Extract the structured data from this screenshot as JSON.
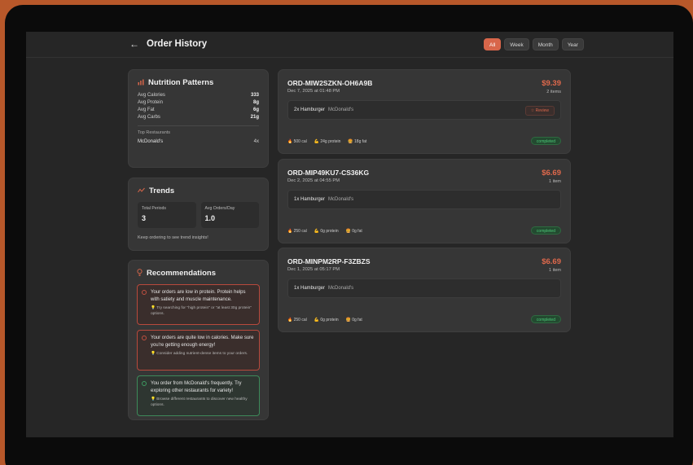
{
  "header": {
    "back_icon": "←",
    "title": "Order History",
    "filters": [
      {
        "label": "All",
        "active": true
      },
      {
        "label": "Week",
        "active": false
      },
      {
        "label": "Month",
        "active": false
      },
      {
        "label": "Year",
        "active": false
      }
    ]
  },
  "nutrition": {
    "title": "Nutrition Patterns",
    "stats": [
      {
        "label": "Avg Calories",
        "value": "333"
      },
      {
        "label": "Avg Protein",
        "value": "8g"
      },
      {
        "label": "Avg Fat",
        "value": "6g"
      },
      {
        "label": "Avg Carbs",
        "value": "21g"
      }
    ],
    "top_restaurants_label": "Top Restaurants",
    "restaurants": [
      {
        "name": "McDonald's",
        "count": "4x"
      }
    ]
  },
  "trends": {
    "title": "Trends",
    "total_periods_label": "Total Periods",
    "total_periods": "3",
    "avg_orders_label": "Avg Orders/Day",
    "avg_orders": "1.0",
    "hint": "Keep ordering to see trend insights!"
  },
  "recommendations": {
    "title": "Recommendations",
    "items": [
      {
        "text": "Your orders are low in protein. Protein helps with satiety and muscle maintenance.",
        "tip": "💡 Try searching for \"high protein\" or \"at least 30g protein\" options."
      },
      {
        "text": "Your orders are quite low in calories. Make sure you're getting enough energy!",
        "tip": "💡 Consider adding nutrient-dense items to your orders."
      },
      {
        "text": "You order from McDonald's frequently. Try exploring other restaurants for variety!",
        "tip": "💡 Browse different restaurants to discover new healthy options."
      }
    ]
  },
  "orders": [
    {
      "id": "ORD-MIW2SZKN-OH6A9B",
      "date": "Dec 7, 2025 at 01:48 PM",
      "price": "$9.39",
      "count": "2 items",
      "item": "2x Hamburger",
      "restaurant": "McDonald's",
      "review": "☆ Review",
      "cal": "🔥 500 cal",
      "protein": "💪 24g protein",
      "fat": "🍔 18g fat",
      "status": "completed"
    },
    {
      "id": "ORD-MIP49KU7-CS36KG",
      "date": "Dec 2, 2025 at 04:55 PM",
      "price": "$6.69",
      "count": "1 item",
      "item": "1x Hamburger",
      "restaurant": "McDonald's",
      "cal": "🔥 250 cal",
      "protein": "💪 0g protein",
      "fat": "🍔 0g fat",
      "status": "completed"
    },
    {
      "id": "ORD-MINPM2RP-F3ZBZS",
      "date": "Dec 1, 2025 at 05:17 PM",
      "price": "$6.69",
      "count": "1 item",
      "item": "1x Hamburger",
      "restaurant": "McDonald's",
      "cal": "🔥 250 cal",
      "protein": "💪 0g protein",
      "fat": "🍔 0g fat",
      "status": "completed"
    }
  ],
  "colors": {
    "accent": "#d8664a",
    "success": "#4cc878",
    "background": "#262626",
    "card": "#363636"
  }
}
